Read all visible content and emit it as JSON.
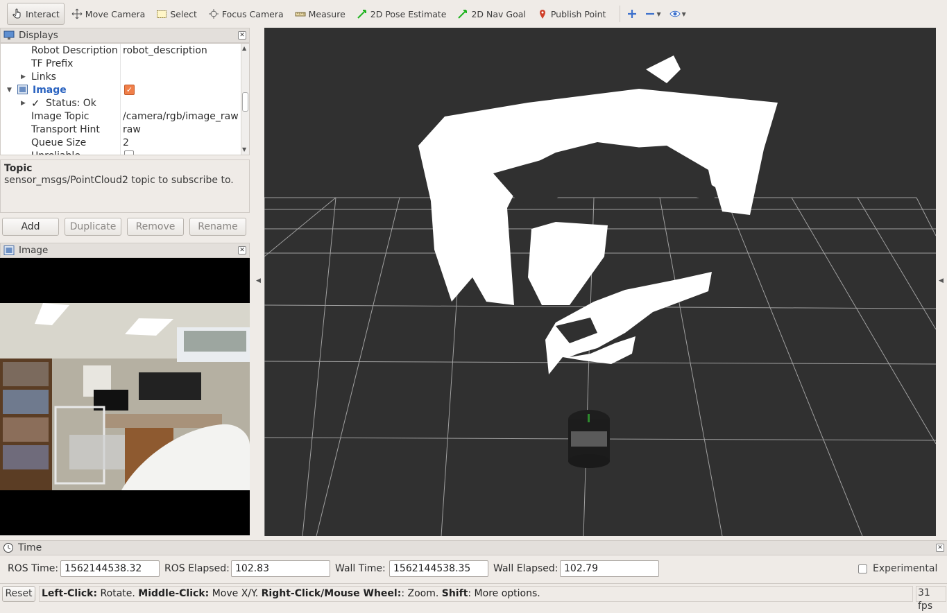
{
  "toolbar": {
    "tools": [
      {
        "label": "Interact",
        "icon": "hand-pointer-icon",
        "active": true
      },
      {
        "label": "Move Camera",
        "icon": "move-arrows-icon"
      },
      {
        "label": "Select",
        "icon": "select-box-icon"
      },
      {
        "label": "Focus Camera",
        "icon": "crosshair-icon"
      },
      {
        "label": "Measure",
        "icon": "ruler-icon"
      },
      {
        "label": "2D Pose Estimate",
        "icon": "green-arrow-icon"
      },
      {
        "label": "2D Nav Goal",
        "icon": "green-arrow-icon"
      },
      {
        "label": "Publish Point",
        "icon": "map-pin-icon"
      }
    ],
    "accent_color": "#3b6fcc"
  },
  "displays_panel": {
    "title": "Displays",
    "rows": [
      {
        "key": "Robot Description",
        "value": "robot_description"
      },
      {
        "key": "TF Prefix",
        "value": ""
      },
      {
        "key": "Links",
        "value": "",
        "expandable": true
      },
      {
        "key": "Image",
        "value": "",
        "checked": true
      },
      {
        "key": "Status: Ok",
        "value": ""
      },
      {
        "key": "Image Topic",
        "value": "/camera/rgb/image_raw"
      },
      {
        "key": "Transport Hint",
        "value": "raw"
      },
      {
        "key": "Queue Size",
        "value": "2"
      },
      {
        "key": "Unreliable",
        "value": ""
      }
    ]
  },
  "topic_help": {
    "heading": "Topic",
    "text": "sensor_msgs/PointCloud2 topic to subscribe to."
  },
  "buttons": {
    "add": "Add",
    "duplicate": "Duplicate",
    "remove": "Remove",
    "rename": "Rename"
  },
  "image_panel": {
    "title": "Image"
  },
  "time_panel": {
    "title": "Time",
    "ros_time_label": "ROS Time:",
    "ros_time": "1562144538.32",
    "ros_elapsed_label": "ROS Elapsed:",
    "ros_elapsed": "102.83",
    "wall_time_label": "Wall Time:",
    "wall_time": "1562144538.35",
    "wall_elapsed_label": "Wall Elapsed:",
    "wall_elapsed": "102.79",
    "experimental_label": "Experimental"
  },
  "statusbar": {
    "reset": "Reset",
    "hint_parts": [
      {
        "b": "Left-Click:",
        "t": " Rotate. "
      },
      {
        "b": "Middle-Click:",
        "t": " Move X/Y. "
      },
      {
        "b": "Right-Click/Mouse Wheel:",
        "t": ": Zoom. "
      },
      {
        "b": "Shift",
        "t": ": More options."
      }
    ],
    "fps": "31 fps"
  }
}
